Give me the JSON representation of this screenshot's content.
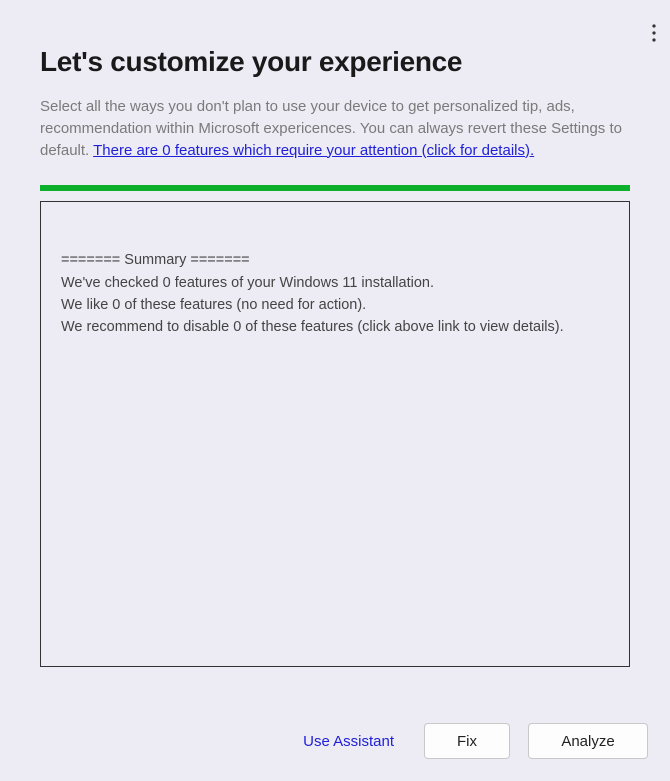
{
  "header": {
    "title": "Let's customize your experience",
    "description_prefix": "Select all the ways you don't plan to use your device to get personalized tip, ads, recommendation within Microsoft expericences. You can always revert these Settings to default. ",
    "attention_link": "There are 0 features which require your attention (click for details)."
  },
  "progress": {
    "color": "#0db02b"
  },
  "summary": {
    "heading": "======= Summary =======",
    "line1": "We've checked 0 features of your Windows 11 installation.",
    "line2": "We like 0 of these features (no need for action).",
    "line3": "We recommend to disable 0 of these features (click above link to view details)."
  },
  "footer": {
    "use_assistant": "Use Assistant",
    "fix": "Fix",
    "analyze": "Analyze"
  }
}
